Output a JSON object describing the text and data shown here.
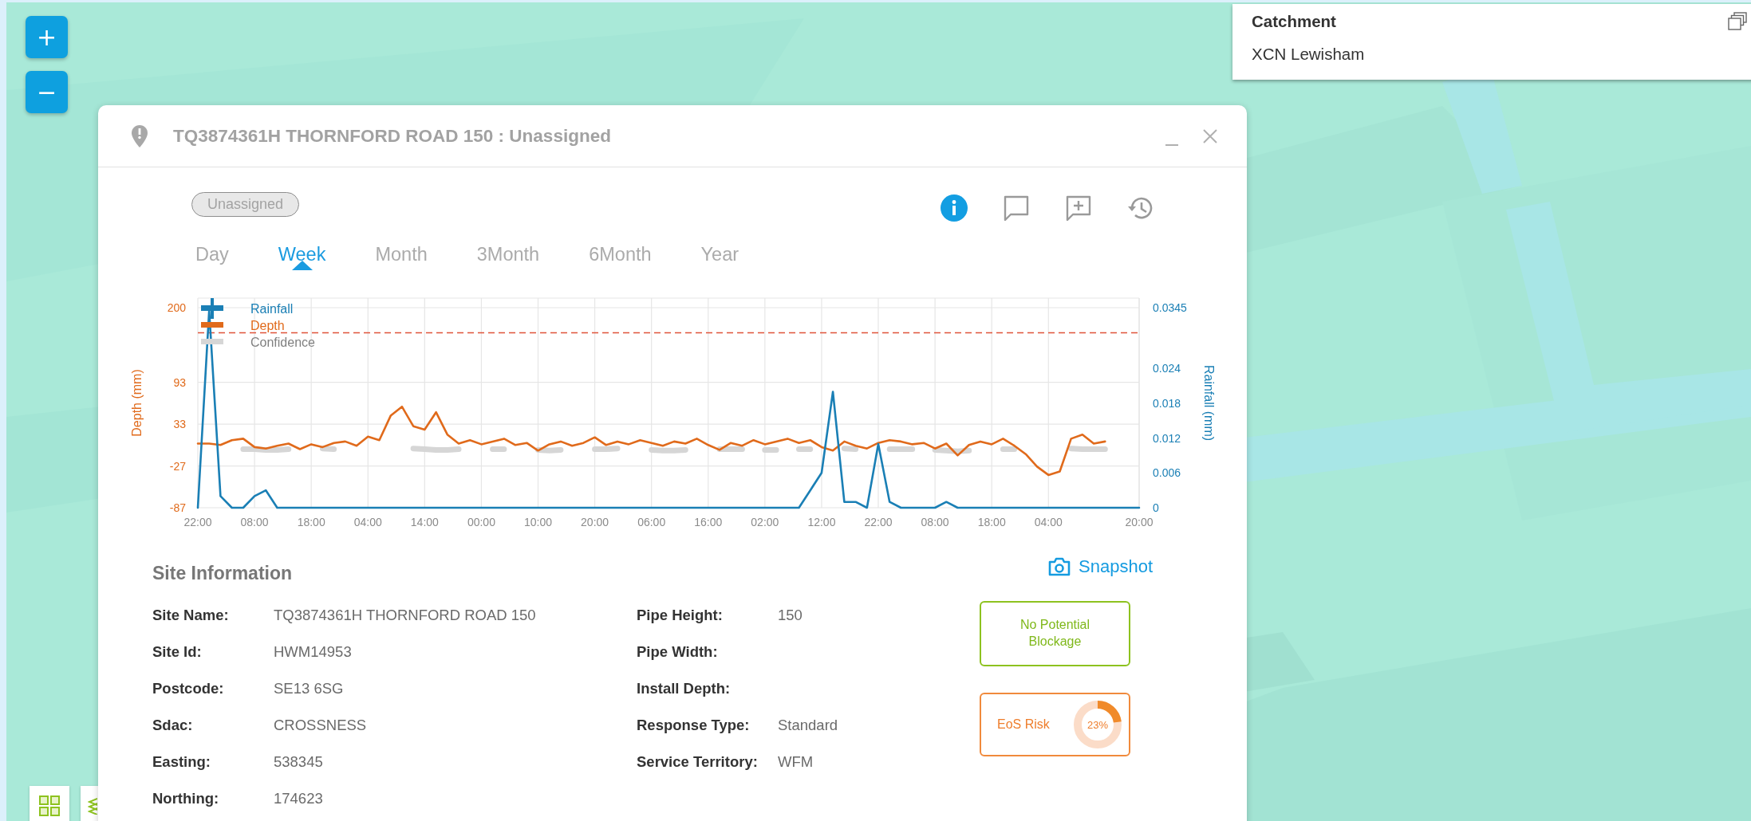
{
  "zoom_controls": [
    {
      "label": "+"
    },
    {
      "label": "−"
    }
  ],
  "catchment_panel": {
    "title": "Catchment",
    "value": "XCN Lewisham"
  },
  "popup": {
    "title": "TQ3874361H THORNFORD ROAD 150 : Unassigned",
    "status_badge": "Unassigned",
    "actions": [
      {
        "kind": "info",
        "selected": true
      },
      {
        "kind": "comment",
        "selected": false
      },
      {
        "kind": "add_comment",
        "selected": false
      },
      {
        "kind": "history",
        "selected": false
      }
    ],
    "tabs": [
      {
        "label": "Day",
        "selected": false
      },
      {
        "label": "Week",
        "selected": true
      },
      {
        "label": "Month",
        "selected": false
      },
      {
        "label": "3Month",
        "selected": false
      },
      {
        "label": "6Month",
        "selected": false
      },
      {
        "label": "Year",
        "selected": false
      }
    ],
    "chart_data": {
      "type": "line",
      "ylabel": "Depth (mm)",
      "y2label": "Rainfall (mm)",
      "categories": [
        "22:00",
        null,
        null,
        null,
        null,
        "08:00",
        null,
        null,
        null,
        null,
        "18:00",
        null,
        null,
        null,
        null,
        "04:00",
        null,
        null,
        null,
        null,
        "14:00",
        null,
        null,
        null,
        null,
        "00:00",
        null,
        null,
        null,
        null,
        "10:00",
        null,
        null,
        null,
        null,
        "20:00",
        null,
        null,
        null,
        null,
        "06:00",
        null,
        null,
        null,
        null,
        "16:00",
        null,
        null,
        null,
        null,
        "02:00",
        null,
        null,
        null,
        null,
        "12:00",
        null,
        null,
        null,
        null,
        "22:00",
        null,
        null,
        null,
        null,
        "08:00",
        null,
        null,
        null,
        null,
        "18:00",
        null,
        null,
        null,
        null,
        "04:00",
        null,
        null,
        null,
        null,
        null,
        null,
        null,
        "20:00"
      ],
      "ylim": [
        -87,
        200
      ],
      "y2lim": [
        0,
        0.0345
      ],
      "yticks": [
        -87,
        -27,
        33,
        93,
        200
      ],
      "y2ticks": [
        0,
        0.006,
        0.012,
        0.018,
        0.024,
        0.0345
      ],
      "series": [
        {
          "name": "Rainfall",
          "color": "#1a7fb5",
          "axis": "y2",
          "values": [
            0,
            0.034,
            0.002,
            0,
            0,
            0.002,
            0.003,
            0,
            0,
            0,
            0,
            0,
            0,
            0,
            0,
            0,
            0,
            0,
            0,
            0,
            0,
            0,
            0,
            0,
            0,
            0,
            0,
            0,
            0,
            0,
            0,
            0,
            0,
            0,
            0,
            0,
            0,
            0,
            0,
            0,
            0,
            0,
            0,
            0,
            0,
            0,
            0,
            0,
            0,
            0,
            0,
            0,
            0,
            0,
            0.003,
            0.006,
            0.02,
            0.001,
            0.001,
            0,
            0.011,
            0.001,
            0,
            0,
            0,
            0,
            0.001,
            0,
            0,
            0,
            0,
            0,
            0,
            0,
            0,
            0,
            0,
            0,
            0,
            0,
            0,
            0,
            0,
            0
          ]
        },
        {
          "name": "Depth",
          "color": "#e06a1b",
          "values": [
            5,
            5,
            3,
            10,
            12,
            0,
            -2,
            2,
            5,
            -3,
            4,
            0,
            6,
            8,
            2,
            15,
            10,
            45,
            58,
            30,
            25,
            50,
            18,
            5,
            10,
            4,
            8,
            12,
            3,
            6,
            -5,
            4,
            8,
            2,
            6,
            14,
            3,
            8,
            4,
            10,
            6,
            2,
            8,
            5,
            12,
            3,
            -4,
            6,
            2,
            10,
            4,
            8,
            12,
            6,
            10,
            0,
            -5,
            8,
            2,
            -2,
            6,
            10,
            8,
            4,
            6,
            -2,
            5,
            -12,
            3,
            8,
            4,
            12,
            2,
            -10,
            -28,
            -40,
            -35,
            12,
            18,
            5,
            8,
            null,
            null,
            null
          ]
        },
        {
          "name": "Confidence",
          "color": "#d6d6d6",
          "values": [
            null,
            null,
            null,
            null,
            -3,
            -3,
            -4,
            -4,
            -3,
            null,
            null,
            -2,
            -3,
            null,
            null,
            null,
            null,
            null,
            null,
            -2,
            -3,
            -4,
            -4,
            -3,
            null,
            null,
            -3,
            -3,
            null,
            null,
            -4,
            -5,
            -4,
            null,
            null,
            -3,
            -3,
            -2,
            null,
            null,
            -4,
            -5,
            -5,
            -4,
            null,
            null,
            -3,
            -3,
            -3,
            null,
            -4,
            -4,
            null,
            -3,
            -3,
            null,
            null,
            -2,
            -3,
            null,
            null,
            -3,
            -3,
            -3,
            null,
            -4,
            -5,
            -6,
            -5,
            null,
            null,
            -3,
            -3,
            null,
            null,
            null,
            null,
            -2,
            -3,
            -3,
            -3,
            null,
            null,
            null
          ]
        }
      ],
      "ref_lines": [
        {
          "axis": "y",
          "value": 164,
          "color": "#e0533a"
        }
      ],
      "grid": true,
      "legend": true
    },
    "site_information": {
      "title": "Site Information",
      "snapshot": "Snapshot",
      "left": [
        {
          "label": "Site Name:",
          "value": "TQ3874361H THORNFORD ROAD 150"
        },
        {
          "label": "Site Id:",
          "value": "HWM14953"
        },
        {
          "label": "Postcode:",
          "value": "SE13 6SG"
        },
        {
          "label": "Sdac:",
          "value": "CROSSNESS"
        },
        {
          "label": "Easting:",
          "value": "538345"
        },
        {
          "label": "Northing:",
          "value": "174623"
        }
      ],
      "right": [
        {
          "label": "Pipe Height:",
          "value": "150"
        },
        {
          "label": "Pipe Width:"
        },
        {
          "label": "Install Depth:"
        },
        {
          "label": "Response Type:",
          "value": "Standard"
        },
        {
          "label": "Service Territory:",
          "value": "WFM"
        }
      ]
    },
    "blockage": {
      "text": "No Potential Blockage"
    },
    "eos_risk": {
      "label": "EoS Risk",
      "reading": "23%"
    }
  }
}
